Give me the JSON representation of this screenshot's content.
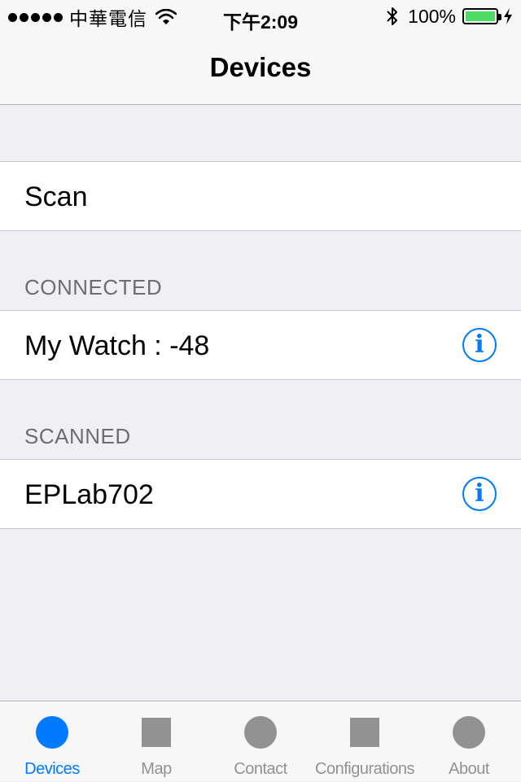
{
  "status_bar": {
    "carrier": "中華電信",
    "time": "下午2:09",
    "battery_percent": "100%",
    "signal_bars": 5,
    "wifi_icon": "wifi-icon",
    "bluetooth_icon": "bluetooth-icon",
    "battery_level": 1.0,
    "charging": true
  },
  "nav": {
    "title": "Devices"
  },
  "scan_cell": {
    "label": "Scan"
  },
  "sections": [
    {
      "header": "CONNECTED",
      "items": [
        {
          "label": "My Watch : -48",
          "accessory": "info-icon"
        }
      ]
    },
    {
      "header": "SCANNED",
      "items": [
        {
          "label": "EPLab702",
          "accessory": "info-icon"
        }
      ]
    }
  ],
  "tab_bar": {
    "active_index": 0,
    "tabs": [
      {
        "label": "Devices",
        "icon": "circle-icon"
      },
      {
        "label": "Map",
        "icon": "square-icon"
      },
      {
        "label": "Contact",
        "icon": "circle-icon"
      },
      {
        "label": "Configurations",
        "icon": "square-icon"
      },
      {
        "label": "About",
        "icon": "circle-icon"
      }
    ]
  },
  "colors": {
    "accent": "#007aff",
    "background": "#efeff4",
    "inactive_tab": "#929292",
    "battery_fill": "#4cd964",
    "section_header": "#6d6d72"
  }
}
